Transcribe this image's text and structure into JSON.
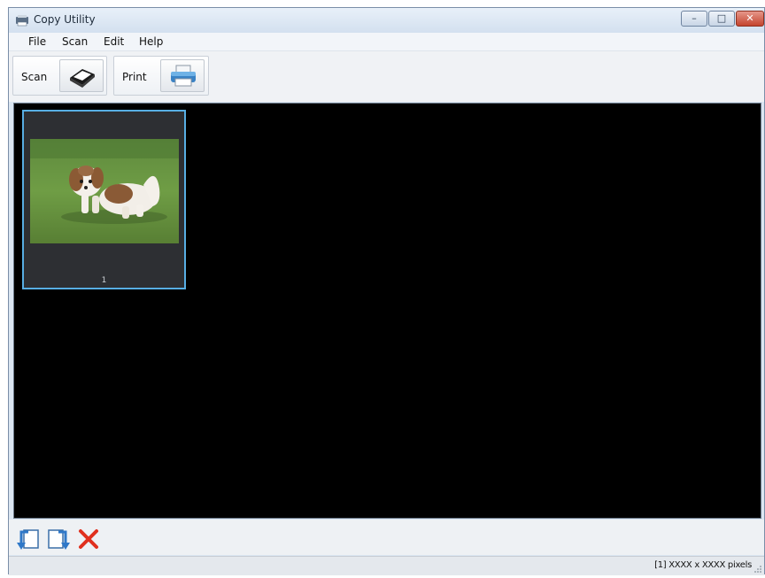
{
  "window": {
    "title": "Copy Utility"
  },
  "menu": [
    "File",
    "Scan",
    "Edit",
    "Help"
  ],
  "toolbar": {
    "scan_label": "Scan",
    "scan_icon": "scanner-icon",
    "print_label": "Print",
    "print_icon": "printer-icon"
  },
  "thumbnails": [
    {
      "number": "1",
      "subject": "puppy on grass",
      "selected": true
    }
  ],
  "actions": [
    {
      "name": "rotate-left",
      "icon": "rotate-left-icon"
    },
    {
      "name": "rotate-right",
      "icon": "rotate-right-icon"
    },
    {
      "name": "delete",
      "icon": "delete-x-icon"
    }
  ],
  "status": {
    "text": "[1] XXXX x XXXX pixels"
  },
  "colors": {
    "selection": "#57aee3",
    "delete": "#e0301e",
    "canvas": "#000000"
  }
}
